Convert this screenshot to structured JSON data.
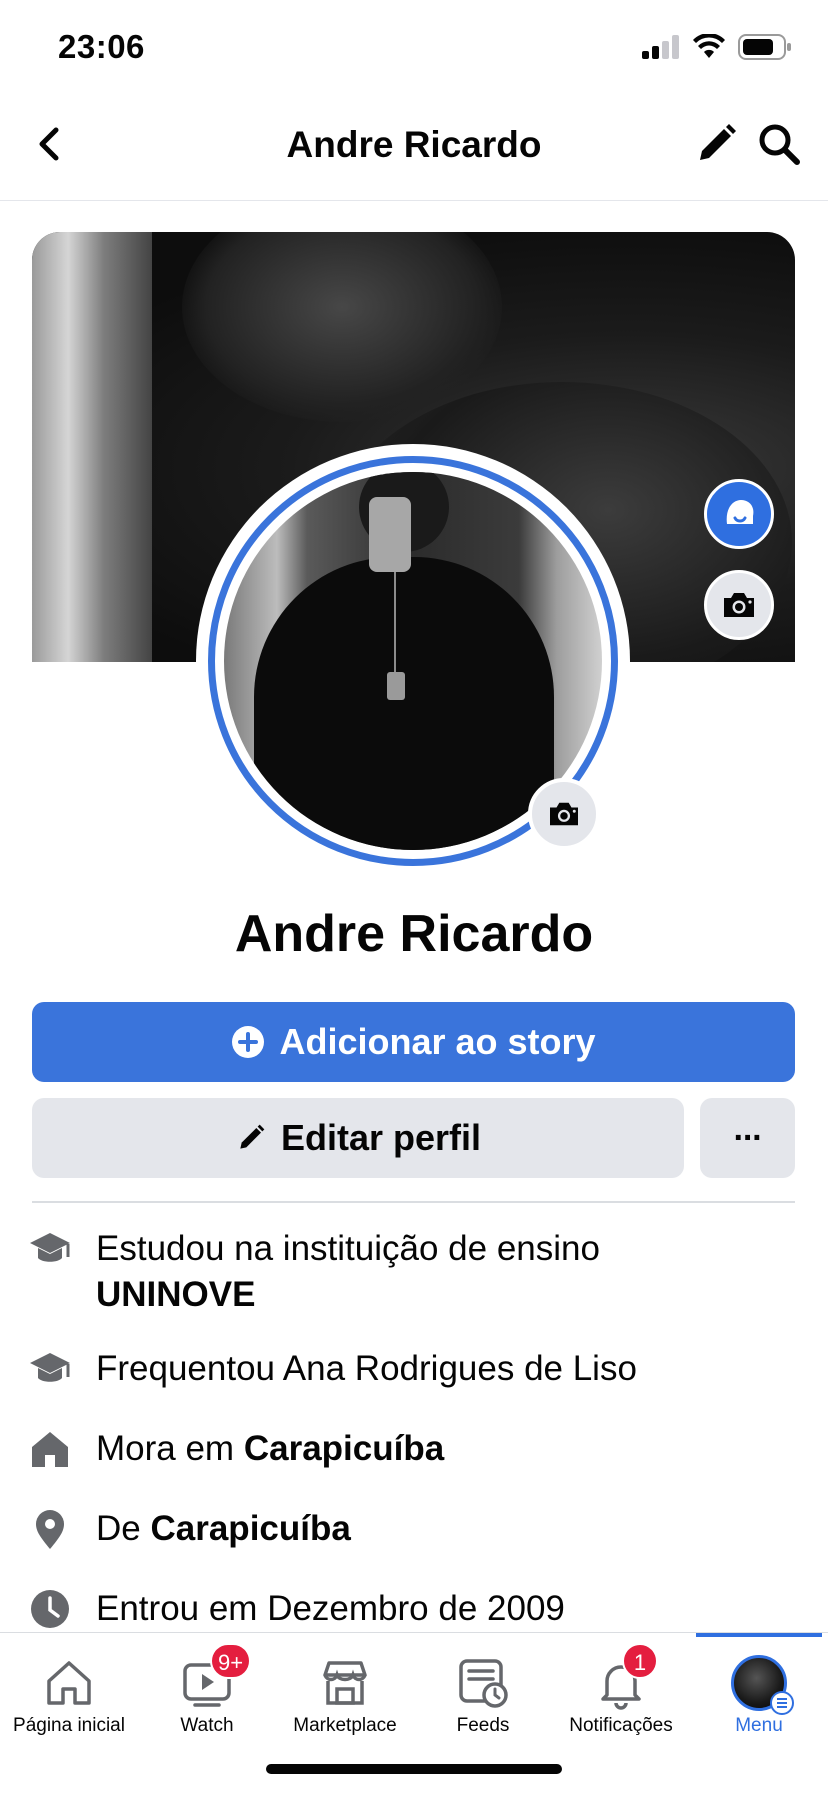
{
  "status_bar": {
    "time": "23:06"
  },
  "header": {
    "title": "Andre Ricardo"
  },
  "profile": {
    "name": "Andre Ricardo",
    "add_story_label": "Adicionar ao story",
    "edit_profile_label": "Editar perfil",
    "more_label": "···"
  },
  "info": [
    {
      "icon": "graduation-cap-icon",
      "prefix": "Estudou na instituição de ensino",
      "bold": "UNINOVE"
    },
    {
      "icon": "graduation-cap-icon",
      "prefix": "Frequentou Ana Rodrigues de Liso",
      "bold": ""
    },
    {
      "icon": "home-icon",
      "prefix": "Mora em",
      "bold": "Carapicuíba"
    },
    {
      "icon": "location-pin-icon",
      "prefix": "De",
      "bold": "Carapicuíba"
    },
    {
      "icon": "clock-icon",
      "prefix": "Entrou em Dezembro de 2009",
      "bold": ""
    }
  ],
  "tabbar": {
    "tabs": [
      {
        "label": "Página inicial",
        "icon": "home-icon"
      },
      {
        "label": "Watch",
        "icon": "video-icon",
        "badge": "9+"
      },
      {
        "label": "Marketplace",
        "icon": "shop-icon"
      },
      {
        "label": "Feeds",
        "icon": "feeds-icon"
      },
      {
        "label": "Notificações",
        "icon": "bell-icon",
        "badge": "1"
      },
      {
        "label": "Menu",
        "icon": "avatar-menu-icon",
        "active": true
      }
    ]
  },
  "colors": {
    "brand_blue": "#3a74db",
    "badge_red": "#e41e3f",
    "button_gray": "#e4e6eb"
  }
}
